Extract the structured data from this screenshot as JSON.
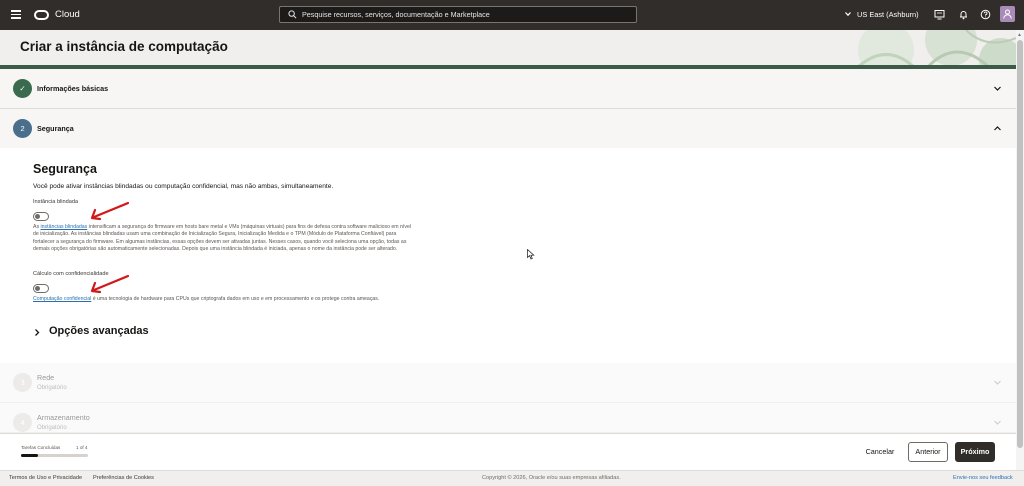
{
  "topbar": {
    "brand": "Cloud",
    "search_placeholder": "Pesquise recursos, serviços, documentação e Marketplace",
    "region": "US East (Ashburn)",
    "icons": [
      "menu-icon",
      "oracle-logo-icon",
      "search-icon",
      "chevron-down-icon",
      "developer-tools-icon",
      "bell-icon",
      "help-icon",
      "user-icon"
    ]
  },
  "page": {
    "title": "Criar a instância de computação"
  },
  "steps": [
    {
      "number": "✓",
      "title": "Informações básicas",
      "subtitle": "",
      "state": "complete",
      "color": "#3a6b4e"
    },
    {
      "number": "2",
      "title": "Segurança",
      "subtitle": "",
      "state": "active",
      "color": "#4a6e8c"
    },
    {
      "number": "3",
      "title": "Rede",
      "subtitle": "Obrigatório",
      "state": "disabled",
      "color": "#d6d3cf"
    },
    {
      "number": "4",
      "title": "Armazenamento",
      "subtitle": "Obrigatório",
      "state": "disabled",
      "color": "#d6d3cf"
    }
  ],
  "security": {
    "title": "Segurança",
    "description": "Você pode ativar instâncias blindadas ou computação confidencial, mas não ambas, simultaneamente.",
    "shielded": {
      "label": "Instância blindada",
      "enabled": false,
      "help_prefix": "As ",
      "help_link": "instâncias blindadas",
      "help_text": " intensificam a segurança do firmware em hosts bare metal e VMs (máquinas virtuais) para fins de defesa contra software malicioso em nível de inicialização. As instâncias blindadas usam uma combinação de Inicialização Segura, Inicialização Medida e o TPM (Módulo de Plataforma Confiável) para fortalecer a segurança do firmware. Em algumas instâncias, essas opções devem ser ativadas juntas. Nesses casos, quando você seleciona uma opção, todas as demais opções obrigatórias são automaticamente selecionadas. Depois que uma instância blindada é iniciada, apenas o nome da instância pode ser alterado."
    },
    "confidential": {
      "label": "Cálculo com confidencialidade",
      "enabled": false,
      "help_link": "Computação confidencial",
      "help_text": " é uma tecnologia de hardware para CPUs que criptografa dados em uso e em processamento e os protege contra ameaças."
    },
    "advanced_label": "Opções avançadas"
  },
  "footer": {
    "progress_label": "Tarefas Concluídas",
    "progress_count": "1 of 4",
    "progress_fraction": 0.25,
    "cancel_label": "Cancelar",
    "previous_label": "Anterior",
    "next_label": "Próximo"
  },
  "legal": {
    "terms": "Termos de Uso e Privacidade",
    "cookies": "Preferências de Cookies",
    "copyright": "Copyright © 2026, Oracle e/ou suas empresas afiliadas.",
    "feedback": "Envie-nos seu feedback"
  },
  "colors": {
    "nav_bg": "#312d2a",
    "annotation_arrow": "#d0191a",
    "link": "#2a6fb0",
    "header_band": "#3b5a48"
  }
}
